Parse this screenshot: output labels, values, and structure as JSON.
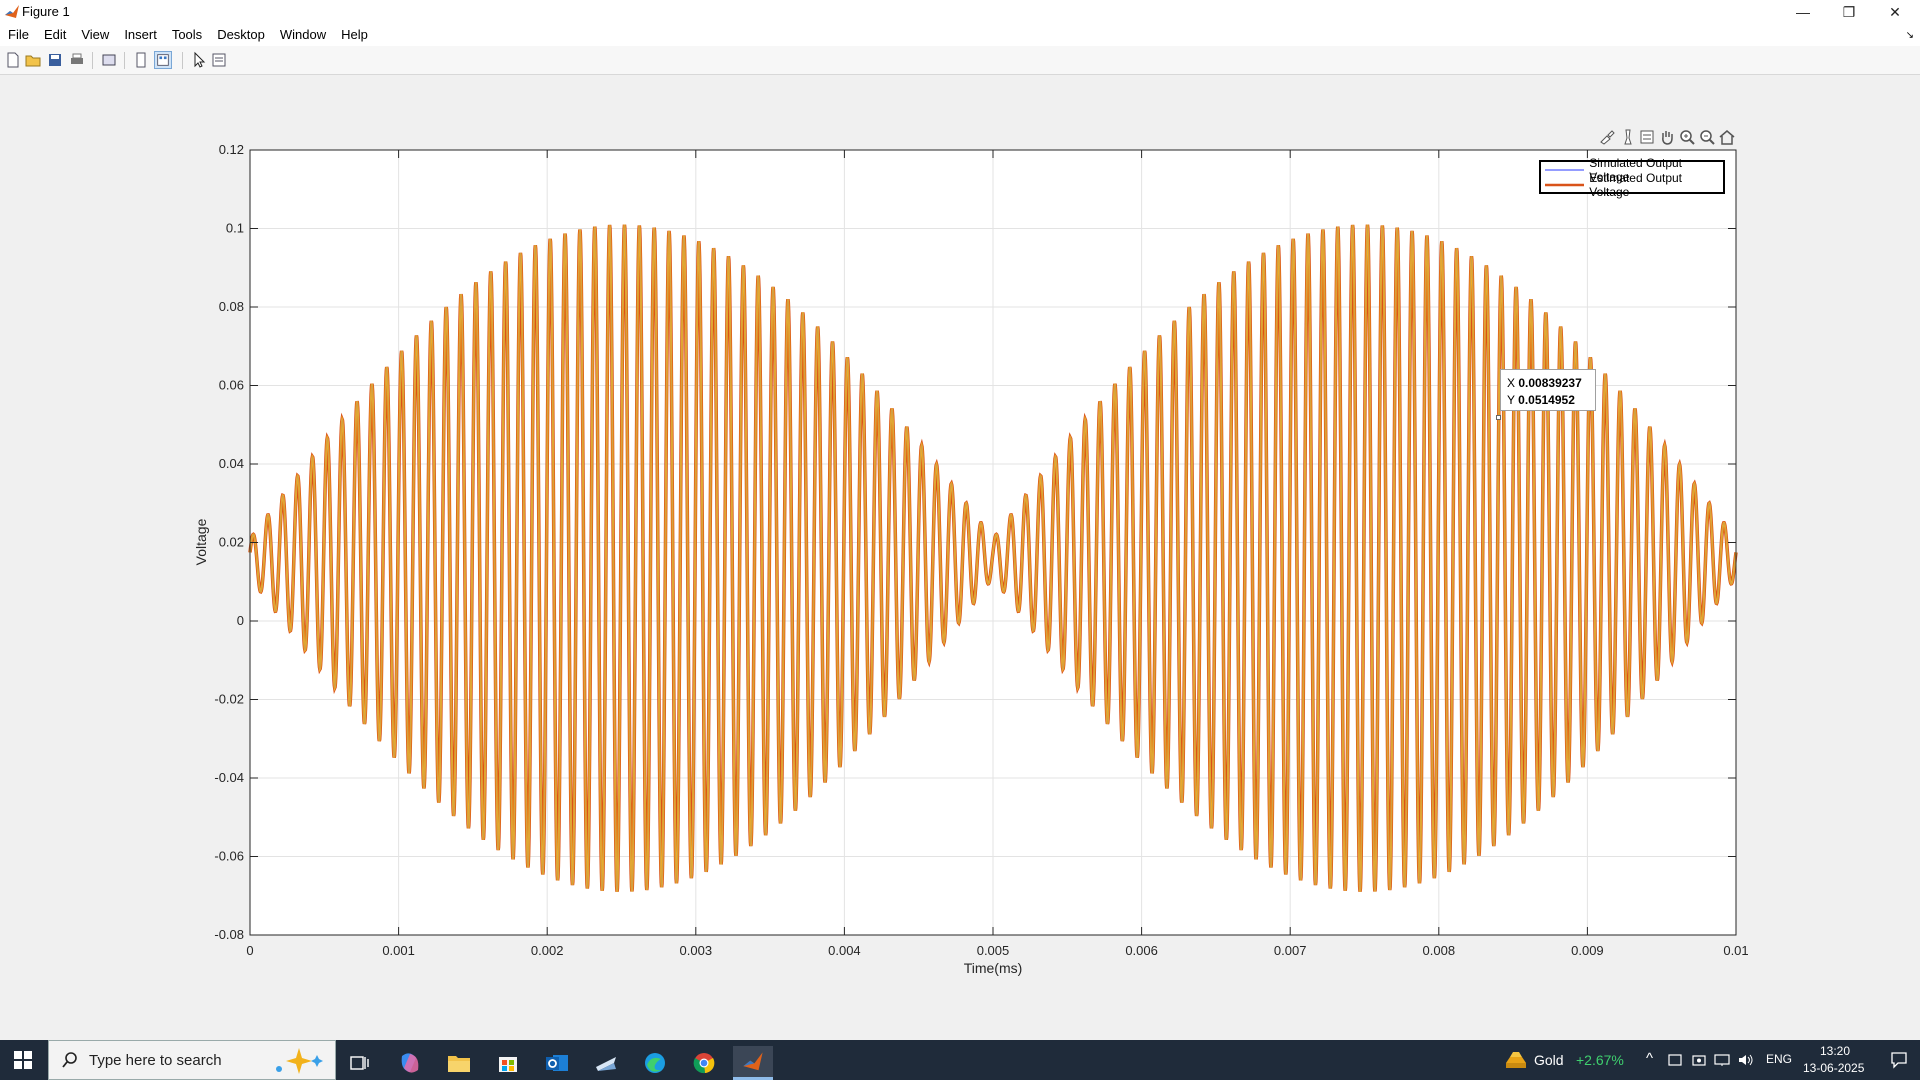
{
  "window": {
    "title": "Figure 1",
    "controls": {
      "minimize": "—",
      "restore": "❐",
      "close": "✕"
    }
  },
  "menu": {
    "items": [
      "File",
      "Edit",
      "View",
      "Insert",
      "Tools",
      "Desktop",
      "Window",
      "Help"
    ],
    "overflow_icon": "↘"
  },
  "toolbar": {
    "icons": [
      "new-figure-icon",
      "open-file-icon",
      "save-icon",
      "print-icon",
      "link-plot-icon",
      "hide-plot-tools-icon",
      "show-plot-tools-icon",
      "edit-plot-icon",
      "property-inspector-icon"
    ]
  },
  "axes_toolbar": {
    "icons": [
      "brush-icon",
      "datatip-icon",
      "pan-icon",
      "zoom-in-icon",
      "zoom-out-icon",
      "restore-view-icon",
      "export-icon"
    ]
  },
  "chart_data": {
    "type": "line",
    "title": "",
    "xlabel": "Time(ms)",
    "ylabel": "Voltage",
    "xlim": [
      0,
      0.01
    ],
    "ylim": [
      -0.08,
      0.12
    ],
    "xticks": [
      "0",
      "0.001",
      "0.002",
      "0.003",
      "0.004",
      "0.005",
      "0.006",
      "0.007",
      "0.008",
      "0.009",
      "0.01"
    ],
    "xtick_values": [
      0,
      0.001,
      0.002,
      0.003,
      0.004,
      0.005,
      0.006,
      0.007,
      0.008,
      0.009,
      0.01
    ],
    "yticks": [
      "0.12",
      "0.1",
      "0.08",
      "0.06",
      "0.04",
      "0.02",
      "0",
      "-0.02",
      "-0.04",
      "-0.06",
      "-0.08"
    ],
    "ytick_values": [
      0.12,
      0.1,
      0.08,
      0.06,
      0.04,
      0.02,
      0,
      -0.02,
      -0.04,
      -0.06,
      -0.08
    ],
    "grid": true,
    "legend_position": "top-right",
    "signal": {
      "offset": 0.016,
      "envelope_peak": 0.085,
      "envelope_min": 0.005,
      "envelope_period": 0.005,
      "carrier_cycles": 100
    },
    "series": [
      {
        "name": "Simulated Output Voltage",
        "color": "#2a3aff",
        "width": 1
      },
      {
        "name": "Estimated Output Voltage",
        "color": "#d95319",
        "width": 2.5
      }
    ],
    "overlay_color": "#f0b024",
    "datatip": {
      "x_label": "X",
      "x_value": "0.00839237",
      "y_label": "Y",
      "y_value": "0.0514952",
      "x": 0.00839237,
      "y": 0.0514952
    }
  },
  "taskbar": {
    "search_placeholder": "Type here to search",
    "weather": {
      "label": "Gold",
      "change": "+2.67%"
    },
    "language": "ENG",
    "time": "13:20",
    "date": "13-06-2025"
  }
}
